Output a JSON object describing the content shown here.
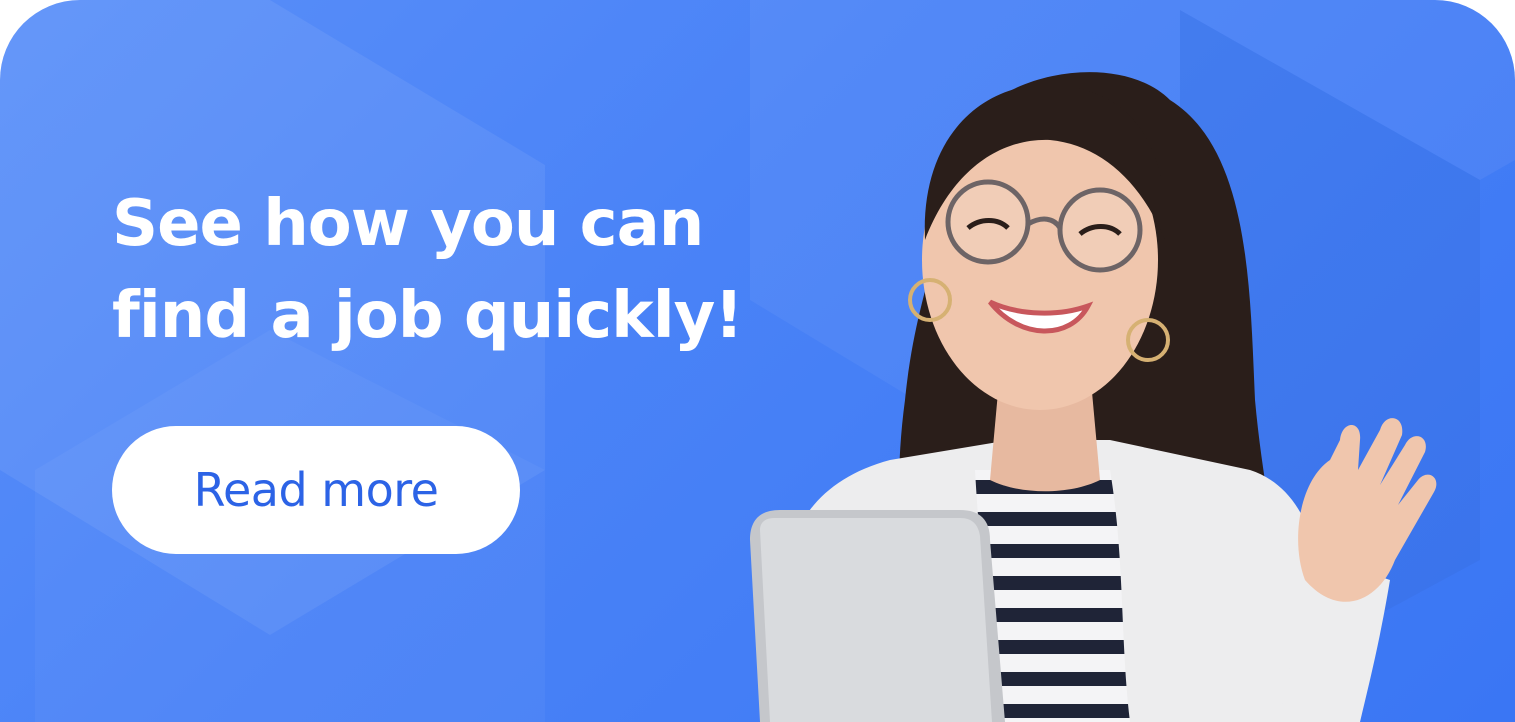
{
  "banner": {
    "headline_line1": "See how you can",
    "headline_line2": "find a job quickly!",
    "cta_label": "Read more"
  },
  "colors": {
    "background_blue": "#4a83f7",
    "cta_text": "#2c63e6",
    "text_white": "#ffffff"
  },
  "icons": {
    "photo": "person-waving-holding-laptop"
  }
}
